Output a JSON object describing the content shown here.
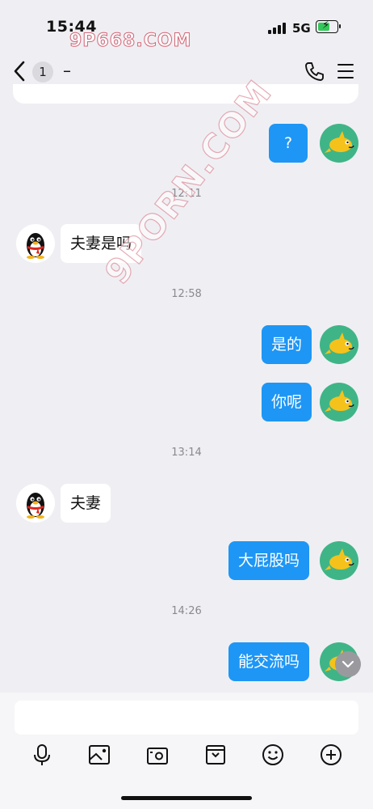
{
  "status_bar": {
    "time": "15:44",
    "network": "5G",
    "watermark": "9P668.COM"
  },
  "nav": {
    "back_count": "1",
    "title": "–"
  },
  "messages": [
    {
      "side": "out",
      "text": "?"
    },
    {
      "timestamp": "12:11"
    },
    {
      "side": "in",
      "text": "夫妻是吗"
    },
    {
      "timestamp": "12:58"
    },
    {
      "side": "out",
      "text": "是的"
    },
    {
      "side": "out",
      "text": "你呢"
    },
    {
      "timestamp": "13:14"
    },
    {
      "side": "in",
      "text": "夫妻"
    },
    {
      "side": "out",
      "text": "大屁股吗"
    },
    {
      "timestamp": "14:26"
    },
    {
      "side": "out",
      "text": "能交流吗"
    }
  ],
  "overlay_watermark": "9PORN.COM",
  "input": {
    "placeholder": ""
  },
  "toolbar_icons": [
    "microphone-icon",
    "image-icon",
    "camera-icon",
    "file-icon",
    "emoji-icon",
    "plus-icon"
  ],
  "colors": {
    "outgoing_bubble": "#1e96f5",
    "incoming_bubble": "#ffffff",
    "background": "#efeff3"
  }
}
